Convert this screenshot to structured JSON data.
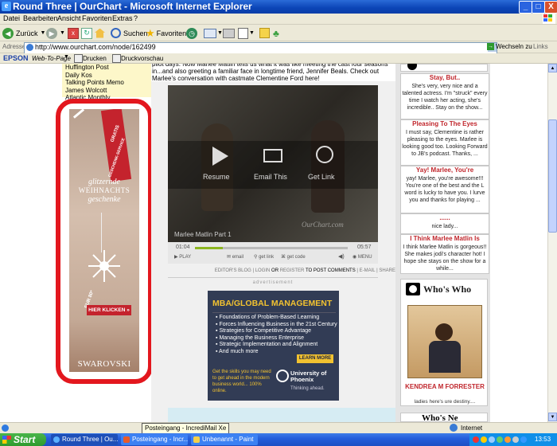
{
  "window": {
    "title": "Round Three | OurChart - Microsoft Internet Explorer",
    "controls": [
      "_",
      "□",
      "X"
    ]
  },
  "menu": [
    "Datei",
    "Bearbeiten",
    "Ansicht",
    "Favoriten",
    "Extras",
    "?"
  ],
  "toolbar": {
    "back": "Zurück",
    "search": "Suchen",
    "favorites": "Favoriten"
  },
  "address": {
    "label": "Adresse",
    "url": "http://www.ourchart.com/node/162499",
    "go": "Wechseln zu",
    "links": "Links"
  },
  "epson_bar": {
    "brand": "EPSON",
    "web_to_page": "Web-To-Page",
    "print": "Drucken",
    "preview": "Druckvorschau"
  },
  "left_links": [
    "Huffington Post",
    "Daily Kos",
    "Talking Points Memo",
    "James Wolcott",
    "Atlantic Monthly"
  ],
  "ad_swarovski": {
    "ribbon": "GRATIS",
    "ribbon2": "GESCHENK-SERVICE",
    "line1": "glitzernde",
    "line2": "WEIHNACHTS",
    "line3": "geschenke",
    "price": "EUR 80*",
    "cta": "HIER KLICKEN »",
    "brand": "SWAROVSKI"
  },
  "article": {
    "text": "pilot days. Now Marlee Matlin tells us what it was like meeting the cast four seasons in...and also greeting a familiar face in longtime friend, Jennifer Beals. Check out Marlee's conversation with castmate Clementine Ford here!"
  },
  "video": {
    "resume": "Resume",
    "email": "Email This",
    "getlink": "Get Link",
    "caption": "Marlee Matlin Part 1",
    "watermark": "OurChart.com",
    "time_current": "01:04",
    "time_total": "05:57",
    "progress": 0.18,
    "controls": [
      "PLAY",
      "email",
      "get link",
      "get code",
      "MENU"
    ]
  },
  "post_links": [
    "EDITOR'S BLOG",
    "LOGIN",
    "OR",
    "REGISTER",
    "TO POST COMMENTS",
    "E-MAIL",
    "SHARE"
  ],
  "advertisement_label": "advertisement",
  "ad_mba": {
    "title": "MBA/GLOBAL MANAGEMENT",
    "bullets": [
      "Foundations of Problem-Based Learning",
      "Forces Influencing Business in the 21st Century",
      "Strategies for Competitive Advantage",
      "Managing the Business Enterprise",
      "Strategic Implementation and Alignment",
      "And much more"
    ],
    "learn_more": "LEARN MORE",
    "promo": "Get the skills you may need to get ahead in the modern business world... 100% online.",
    "university": "University of Phoenix",
    "tagline": "Thinking ahead."
  },
  "comments": [
    {
      "title": "Stay, But..",
      "body": "She's very, very nice and a talented actress. I'm \"struck\" every time I watch her acting, she's incredible.. Stay on the show..."
    },
    {
      "title": "Pleasing To The Eyes",
      "body": "I must say, Clementine is rather pleasing to the eyes. Marlee is looking good too. Looking Forward to JB's podcast. Thanks, ..."
    },
    {
      "title": "Yay! Marlee, You're",
      "body": "yay! Marlee, you're awesome!!! You're one of the best and the L word is lucky to have you. I lurve you and thanks for playing ..."
    },
    {
      "title": "......",
      "body": "nice lady..."
    },
    {
      "title": "I Think Marlee Matlin Is",
      "body": "I think Marlee Matlin is gorgeous!! She makes jodi's character hot! I hope she stays on the show for a while..."
    }
  ],
  "whos_who": {
    "title": "Who's Who",
    "name": "KENDREA M FORRESTER",
    "tagline": "ladies here's ure destiny....",
    "next": "Who's Ne"
  },
  "status": {
    "text": "Posteingang - IncrediMail Xe",
    "zone": "Internet"
  },
  "taskbar": {
    "start": "Start",
    "tasks": [
      "Round Three | Ou...",
      "Posteingang - Incr...",
      "Unbenannt - Paint"
    ],
    "clock": "13:53"
  }
}
